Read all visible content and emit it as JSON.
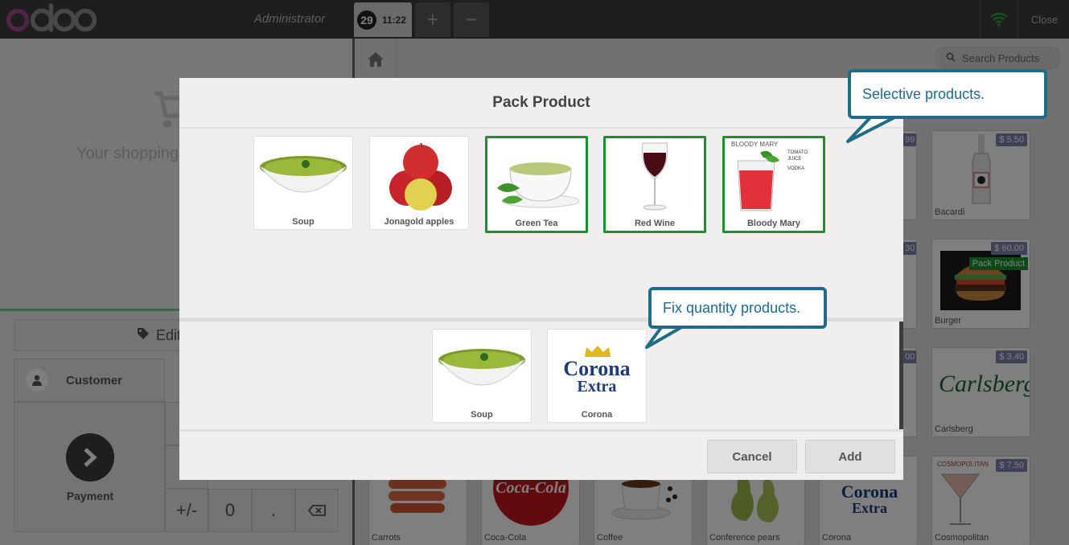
{
  "header": {
    "user": "Administrator",
    "order_number": "29",
    "order_time": "11:22",
    "add_order": "+",
    "remove_order": "−",
    "close_label": "Close"
  },
  "order": {
    "empty_message": "Your shopping",
    "edit_label": "Edit",
    "customer_label": "Customer",
    "payment_label": "Payment"
  },
  "numpad": [
    {
      "label": "+/-",
      "name": "numpad-sign-key"
    },
    {
      "label": "0",
      "name": "numpad-zero-key"
    },
    {
      "label": ".",
      "name": "numpad-decimal-key"
    }
  ],
  "search": {
    "placeholder": "Search Products"
  },
  "products": [
    {
      "name": "Bacardi",
      "price": "$ 5.50"
    },
    {
      "name": "Burger",
      "price": "$ 60.00",
      "badge": "Pack Product"
    },
    {
      "name": "Carlsberg",
      "price": "$ 3.40"
    },
    {
      "name": "Carrots",
      "price": ""
    },
    {
      "name": "Coca-Cola",
      "price": ""
    },
    {
      "name": "Coffee",
      "price": ""
    },
    {
      "name": "Conference pears",
      "price": ""
    },
    {
      "name": "Corona",
      "price": ""
    },
    {
      "name": "Cosmopolitan",
      "price": "$ 7.50"
    }
  ],
  "partial_prices": [
    "99",
    "30",
    "00",
    "30"
  ],
  "modal": {
    "title": "Pack Product",
    "selective_products": [
      {
        "name": "Soup",
        "selected": false
      },
      {
        "name": "Jonagold apples",
        "selected": false
      },
      {
        "name": "Green Tea",
        "selected": true
      },
      {
        "name": "Red Wine",
        "selected": true
      },
      {
        "name": "Bloody Mary",
        "selected": true
      }
    ],
    "fixed_products": [
      {
        "name": "Soup"
      },
      {
        "name": "Corona"
      }
    ],
    "cancel_label": "Cancel",
    "add_label": "Add"
  },
  "image_text": {
    "bloody_mary": {
      "title": "BLOODY MARY",
      "lines": [
        "TOMATO JUICE",
        "VODKA"
      ]
    },
    "corona": {
      "line1": "Corona",
      "line2": "Extra"
    },
    "carlsberg": "Carlsberg",
    "cocacola": "Coca-Cola",
    "cosmopolitan": "COSMOPOLITAN"
  },
  "callouts": {
    "selective": "Selective products.",
    "fixed": "Fix quantity products."
  },
  "colors": {
    "topbar": "#3c3c3c",
    "selected_border": "#19922d",
    "price_tag": "#7f82ac",
    "callout_border": "#1e6c86",
    "callout_text": "#1a6c93"
  }
}
